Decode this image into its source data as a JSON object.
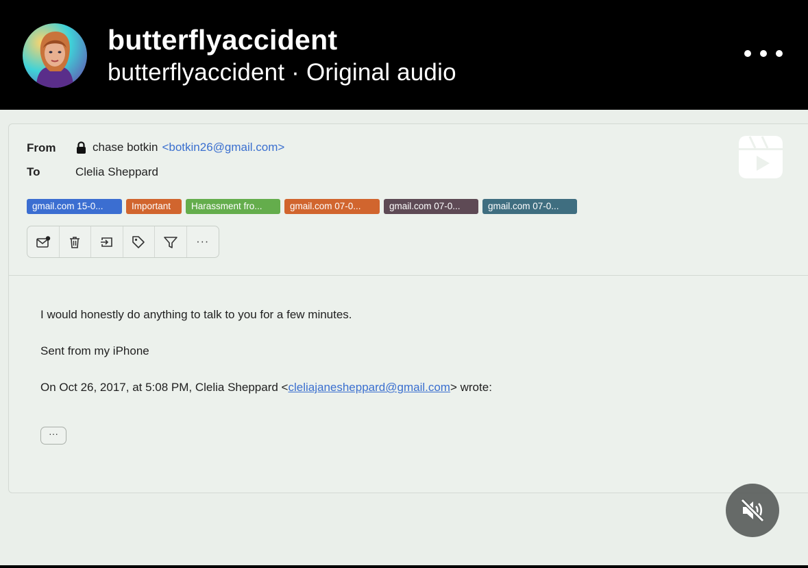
{
  "post": {
    "username": "butterflyaccident",
    "audio_line": "butterflyaccident · Original audio"
  },
  "email": {
    "from_label": "From",
    "from_name": "chase botkin",
    "from_email": "<botkin26@gmail.com>",
    "to_label": "To",
    "to_name": "Clelia Sheppard",
    "tags": [
      {
        "label": "gmail.com 15-0...",
        "color": "#3b6ed1"
      },
      {
        "label": "Important",
        "color": "#d1652e"
      },
      {
        "label": "Harassment fro...",
        "color": "#64ad4c"
      },
      {
        "label": "gmail.com 07-0...",
        "color": "#d1652e"
      },
      {
        "label": "gmail.com 07-0...",
        "color": "#5e4a55"
      },
      {
        "label": "gmail.com 07-0...",
        "color": "#3f6e80"
      }
    ],
    "toolbar_icons": [
      "mark-unread-icon",
      "trash-icon",
      "move-icon",
      "tag-icon",
      "filter-icon",
      "more-icon"
    ],
    "more_symbol": "···",
    "body_line1": "I would honestly do anything to talk to you for a few minutes.",
    "body_line2": "Sent from my iPhone",
    "quote_prefix": "On Oct 26, 2017, at 5:08 PM, Clelia Sheppard <",
    "quote_email": "cleliajanesheppard@gmail.com",
    "quote_suffix": "> wrote:",
    "expand_label": "···"
  },
  "overlay": {
    "reels_icon": "reels-icon",
    "mute_icon": "muted-speaker-icon"
  }
}
